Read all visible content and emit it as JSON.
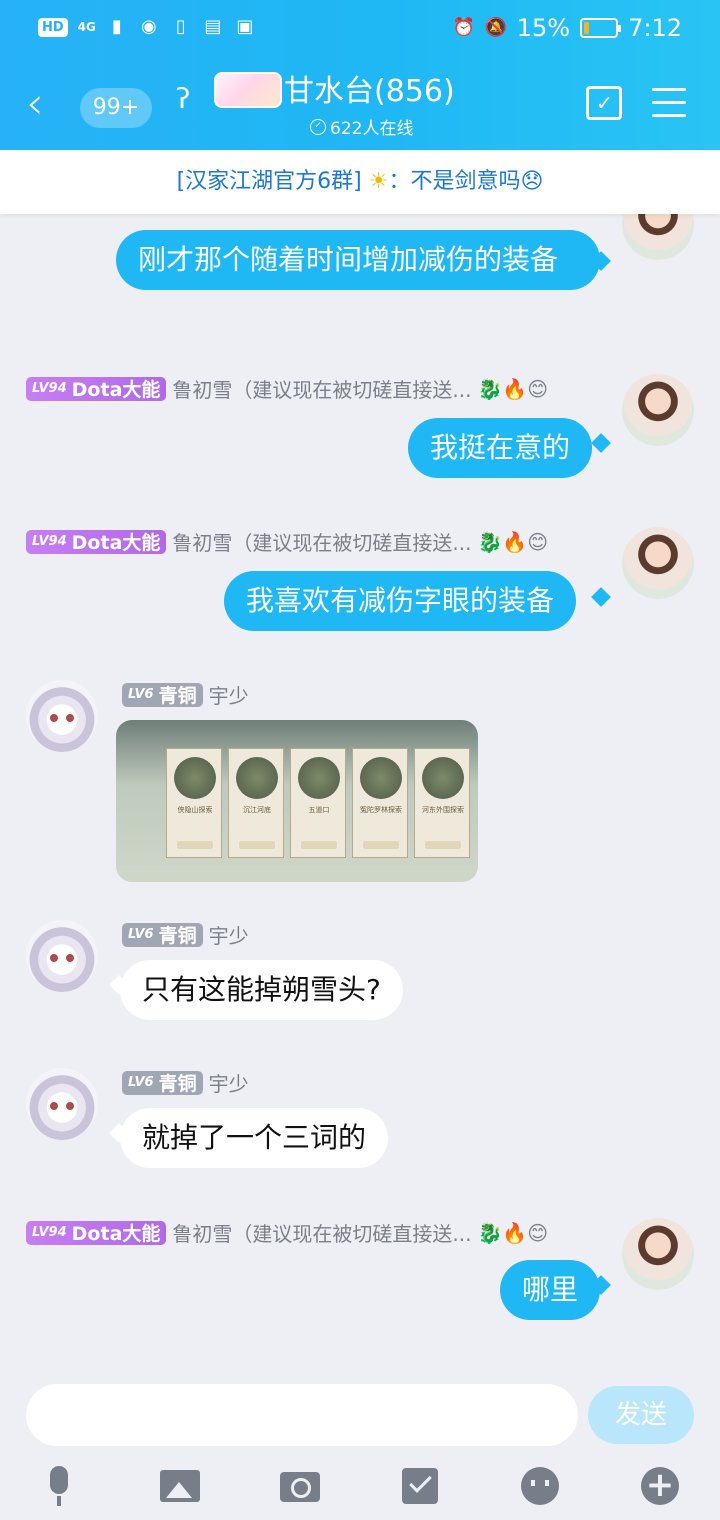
{
  "status_bar": {
    "hd": "HD",
    "network": "4G",
    "battery_percent": "15%",
    "battery_level": 0.15,
    "time": "7:12",
    "colors": {
      "battery_fill": "#f0b429"
    }
  },
  "header": {
    "unread": "99+",
    "title": "甘水台(856)",
    "online": "622人在线",
    "colors": {
      "bar_start": "#27b2f7",
      "bar_end": "#29c4f4"
    }
  },
  "notice": {
    "group": "[汉家江湖官方6群]",
    "sun": "☀",
    "text": "：不是剑意吗😞"
  },
  "messages": [
    {
      "side": "out",
      "text": "刚才那个随着时间增加减伤的装备"
    },
    {
      "side": "out",
      "badge_level": "LV94",
      "badge_title": "Dota大能",
      "sender": "鲁初雪（建议现在被切磋直接送...",
      "decor": "🐉🔥😊",
      "text": "我挺在意的"
    },
    {
      "side": "out",
      "badge_level": "LV94",
      "badge_title": "Dota大能",
      "sender": "鲁初雪（建议现在被切磋直接送...",
      "decor": "🐉🔥😊",
      "text": "我喜欢有减伤字眼的装备"
    },
    {
      "side": "in",
      "badge_level": "LV6",
      "badge_title": "青铜",
      "sender": "宇少",
      "image_cards": [
        "侠隐山探索",
        "沉江河底",
        "五道口",
        "冤陀罗林探索",
        "河东外围探索"
      ]
    },
    {
      "side": "in",
      "badge_level": "LV6",
      "badge_title": "青铜",
      "sender": "宇少",
      "text": "只有这能掉朔雪头?"
    },
    {
      "side": "in",
      "badge_level": "LV6",
      "badge_title": "青铜",
      "sender": "宇少",
      "text": "就掉了一个三词的"
    },
    {
      "side": "out",
      "badge_level": "LV94",
      "badge_title": "Dota大能",
      "sender": "鲁初雪（建议现在被切磋直接送...",
      "decor": "🐉🔥😊",
      "text": "哪里"
    }
  ],
  "input": {
    "placeholder": "",
    "send_label": "发送"
  },
  "toolbar": [
    "mic-icon",
    "image-icon",
    "camera-icon",
    "red-packet-icon",
    "emoji-icon",
    "plus-icon"
  ]
}
